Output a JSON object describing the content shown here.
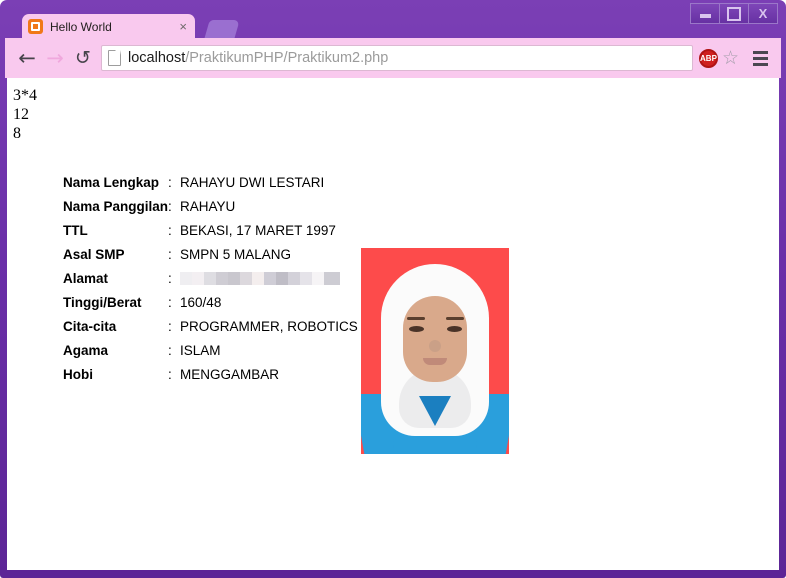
{
  "window": {
    "controls": {
      "minimize": "minimize",
      "maximize": "maximize",
      "close": "X"
    }
  },
  "tab": {
    "title": "Hello World",
    "close_label": "×",
    "favicon": "xampp-icon",
    "newtab_label": ""
  },
  "toolbar": {
    "back_icon": "←",
    "forward_icon": "→",
    "reload_icon": "↻",
    "url_host": "localhost",
    "url_path": "/PraktikumPHP/Praktikum2.php",
    "url_full": "localhost/PraktikumPHP/Praktikum2.php",
    "abp_label": "ABP",
    "star_icon": "☆",
    "menu_icon": "hamburger-menu"
  },
  "page": {
    "output_lines": [
      "3*4",
      "12",
      "8"
    ],
    "bio_rows": [
      {
        "label": "Nama Lengkap",
        "colon": ":",
        "value": "RAHAYU DWI LESTARI",
        "redacted": false
      },
      {
        "label": "Nama Panggilan",
        "colon": ":",
        "value": "RAHAYU",
        "redacted": false
      },
      {
        "label": "TTL",
        "colon": ":",
        "value": "BEKASI, 17 MARET 1997",
        "redacted": false
      },
      {
        "label": "Asal SMP",
        "colon": ":",
        "value": "SMPN 5 MALANG",
        "redacted": false
      },
      {
        "label": "Alamat",
        "colon": ":",
        "value": "",
        "redacted": true
      },
      {
        "label": "Tinggi/Berat",
        "colon": ":",
        "value": "160/48",
        "redacted": false
      },
      {
        "label": "Cita-cita",
        "colon": ":",
        "value": "PROGRAMMER, ROBOTICS",
        "redacted": false
      },
      {
        "label": "Agama",
        "colon": ":",
        "value": "ISLAM",
        "redacted": false
      },
      {
        "label": "Hobi",
        "colon": ":",
        "value": "MENGGAMBAR",
        "redacted": false
      }
    ],
    "photo": {
      "alt": "portrait-photo",
      "background_color": "#fd4b4b",
      "garment_color": "#2a9fdc",
      "headscarf_color": "#fbfbfb"
    }
  },
  "colors": {
    "window_frame": "#6a2fa8",
    "toolbar": "#f9c9ee",
    "tab_active": "#f9c9ee",
    "newtab": "#9a6fd0"
  }
}
